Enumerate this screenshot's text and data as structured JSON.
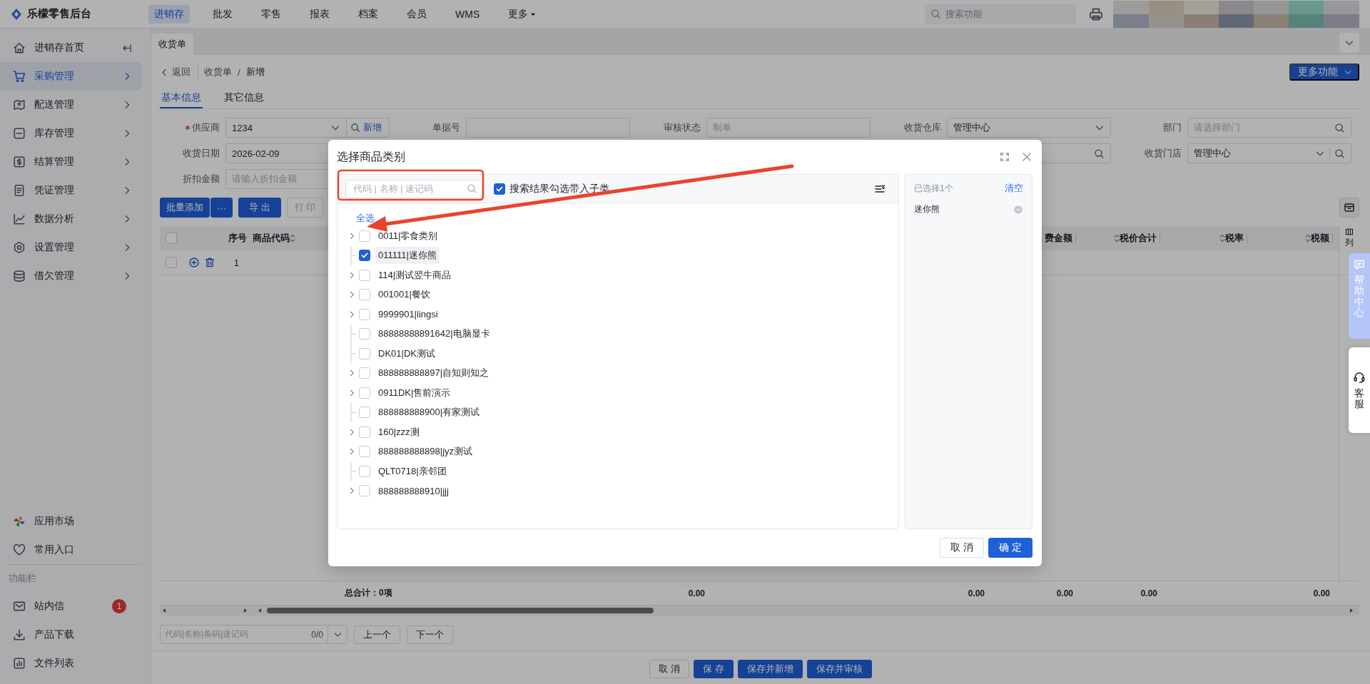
{
  "app": {
    "title": "乐檬零售后台"
  },
  "top_nav": [
    {
      "label": "进销存",
      "selected": true,
      "kind": "link"
    },
    {
      "label": "批发",
      "selected": false,
      "kind": "link"
    },
    {
      "label": "零售",
      "selected": false,
      "kind": "link"
    },
    {
      "label": "报表",
      "selected": false,
      "kind": "link"
    },
    {
      "label": "档案",
      "selected": false,
      "kind": "link"
    },
    {
      "label": "会员",
      "selected": false,
      "kind": "link"
    },
    {
      "label": "WMS",
      "selected": false,
      "kind": "link"
    },
    {
      "label": "更多",
      "selected": false,
      "kind": "dropdown"
    }
  ],
  "search": {
    "placeholder": "搜索功能"
  },
  "sidebar": {
    "items": [
      {
        "label": "进销存首页",
        "kind": "page",
        "selected": false
      },
      {
        "label": "采购管理",
        "kind": "menu",
        "selected": true
      },
      {
        "label": "配送管理",
        "kind": "menu",
        "selected": false
      },
      {
        "label": "库存管理",
        "kind": "menu",
        "selected": false
      },
      {
        "label": "结算管理",
        "kind": "menu",
        "selected": false
      },
      {
        "label": "凭证管理",
        "kind": "menu",
        "selected": false
      },
      {
        "label": "数据分析",
        "kind": "menu",
        "selected": false
      },
      {
        "label": "设置管理",
        "kind": "menu",
        "selected": false
      },
      {
        "label": "借欠管理",
        "kind": "menu",
        "selected": false
      }
    ],
    "links": [
      {
        "label": "应用市场"
      },
      {
        "label": "常用入口"
      }
    ],
    "section_title": "功能栏",
    "tools": [
      {
        "label": "站内信",
        "badge": "1"
      },
      {
        "label": "产品下载"
      },
      {
        "label": "文件列表"
      }
    ]
  },
  "page_tabs": [
    {
      "label": "收货单",
      "selected": true
    }
  ],
  "breadcrumb": {
    "back": "返回",
    "separator": "/",
    "items": [
      "收货单",
      "新增"
    ]
  },
  "more_button": "更多功能",
  "form_tabs": [
    {
      "label": "基本信息",
      "selected": true
    },
    {
      "label": "其它信息",
      "selected": false
    }
  ],
  "form_rows": [
    [
      {
        "label": "供应商",
        "required": true,
        "kind": "supplier",
        "value": "1234",
        "action": "新增"
      },
      {
        "label": "单据号",
        "required": false,
        "kind": "text"
      },
      {
        "label": "审核状态",
        "required": false,
        "kind": "text",
        "placeholder": "制单"
      },
      {
        "label": "收货仓库",
        "required": false,
        "kind": "select",
        "value": "管理中心"
      },
      {
        "label": "部门",
        "required": false,
        "kind": "search",
        "placeholder": "请选择部门"
      }
    ],
    [
      {
        "label": "收货日期",
        "required": false,
        "kind": "text",
        "value": "2026-02-09"
      },
      {
        "kind": "blank"
      },
      {
        "kind": "blank"
      },
      {
        "kind": "search"
      },
      {
        "label": "收货门店",
        "required": false,
        "kind": "select_search",
        "value": "管理中心"
      }
    ],
    [
      {
        "label": "折扣金额",
        "required": false,
        "kind": "text",
        "placeholder": "请输入折扣金额"
      }
    ]
  ],
  "toolbar": {
    "batch_add": "批量添加",
    "batch_menu": "···",
    "buttons": [
      {
        "label": "导 出",
        "kind": "primary"
      },
      {
        "label": "打 印",
        "kind": "default"
      }
    ]
  },
  "table": {
    "all_checked": false,
    "columns": [
      {
        "label": "序号",
        "sortable": false
      },
      {
        "label": "商品代码",
        "sortable": true
      },
      {
        "label": "费金额",
        "sortable": false
      },
      {
        "label": "税价合计",
        "sortable": true
      },
      {
        "label": "税率",
        "sortable": true
      },
      {
        "label": "税额",
        "sortable": true
      }
    ],
    "column_settings": "列",
    "rows": [
      {
        "index": "1",
        "checked": false
      }
    ],
    "totals": {
      "label": "总合计：0项",
      "values": [
        "0.00",
        "0.00",
        "0.00",
        "0.00",
        "0.00"
      ]
    }
  },
  "find_bar": {
    "placeholder": "代码|名称|条码|速记码",
    "count": "0/0",
    "prev": "上一个",
    "next": "下一个"
  },
  "footer_buttons": [
    {
      "label": "取 消",
      "kind": "default"
    },
    {
      "label": "保 存",
      "kind": "primary"
    },
    {
      "label": "保存并新增",
      "kind": "primary"
    },
    {
      "label": "保存并审核",
      "kind": "primary"
    }
  ],
  "side_tabs": [
    {
      "label": "帮助中心",
      "kind": "help"
    },
    {
      "label": "客服",
      "kind": "service"
    }
  ],
  "dialog": {
    "title": "选择商品类别",
    "search_placeholder": "代码 | 名称 | 速记码",
    "include_children": {
      "label": "搜索结果勾选带入子类",
      "checked": true
    },
    "select_all": "全选",
    "tree": [
      {
        "label": "0011|零食类别",
        "kind": "branch",
        "checked": false,
        "selected": false
      },
      {
        "label": "011111|迷你熊",
        "kind": "leaf",
        "checked": true,
        "selected": true
      },
      {
        "label": "114|测试翌牛商品",
        "kind": "branch",
        "checked": false,
        "selected": false
      },
      {
        "label": "001001|餐饮",
        "kind": "branch",
        "checked": false,
        "selected": false
      },
      {
        "label": "9999901|lingsi",
        "kind": "branch",
        "checked": false,
        "selected": false
      },
      {
        "label": "88888888891642|电脑显卡",
        "kind": "leaf",
        "checked": false,
        "selected": false
      },
      {
        "label": "DK01|DK测试",
        "kind": "leaf",
        "checked": false,
        "selected": false
      },
      {
        "label": "888888888897|自知则知之",
        "kind": "branch",
        "checked": false,
        "selected": false
      },
      {
        "label": "0911DK|售前演示",
        "kind": "branch",
        "checked": false,
        "selected": false
      },
      {
        "label": "888888888900|有家测试",
        "kind": "leaf",
        "checked": false,
        "selected": false
      },
      {
        "label": "160|zzz测",
        "kind": "branch",
        "checked": false,
        "selected": false
      },
      {
        "label": "888888888898|jyz测试",
        "kind": "branch",
        "checked": false,
        "selected": false
      },
      {
        "label": "QLT0718|亲邻团",
        "kind": "leaf",
        "checked": false,
        "selected": false
      },
      {
        "label": "888888888910|jjj",
        "kind": "branch",
        "checked": false,
        "selected": false
      }
    ],
    "selected_panel": {
      "summary": "已选择1个",
      "clear": "清空",
      "items": [
        "迷你熊"
      ]
    },
    "buttons": [
      {
        "label": "取 消",
        "kind": "default"
      },
      {
        "label": "确 定",
        "kind": "primary"
      }
    ]
  }
}
